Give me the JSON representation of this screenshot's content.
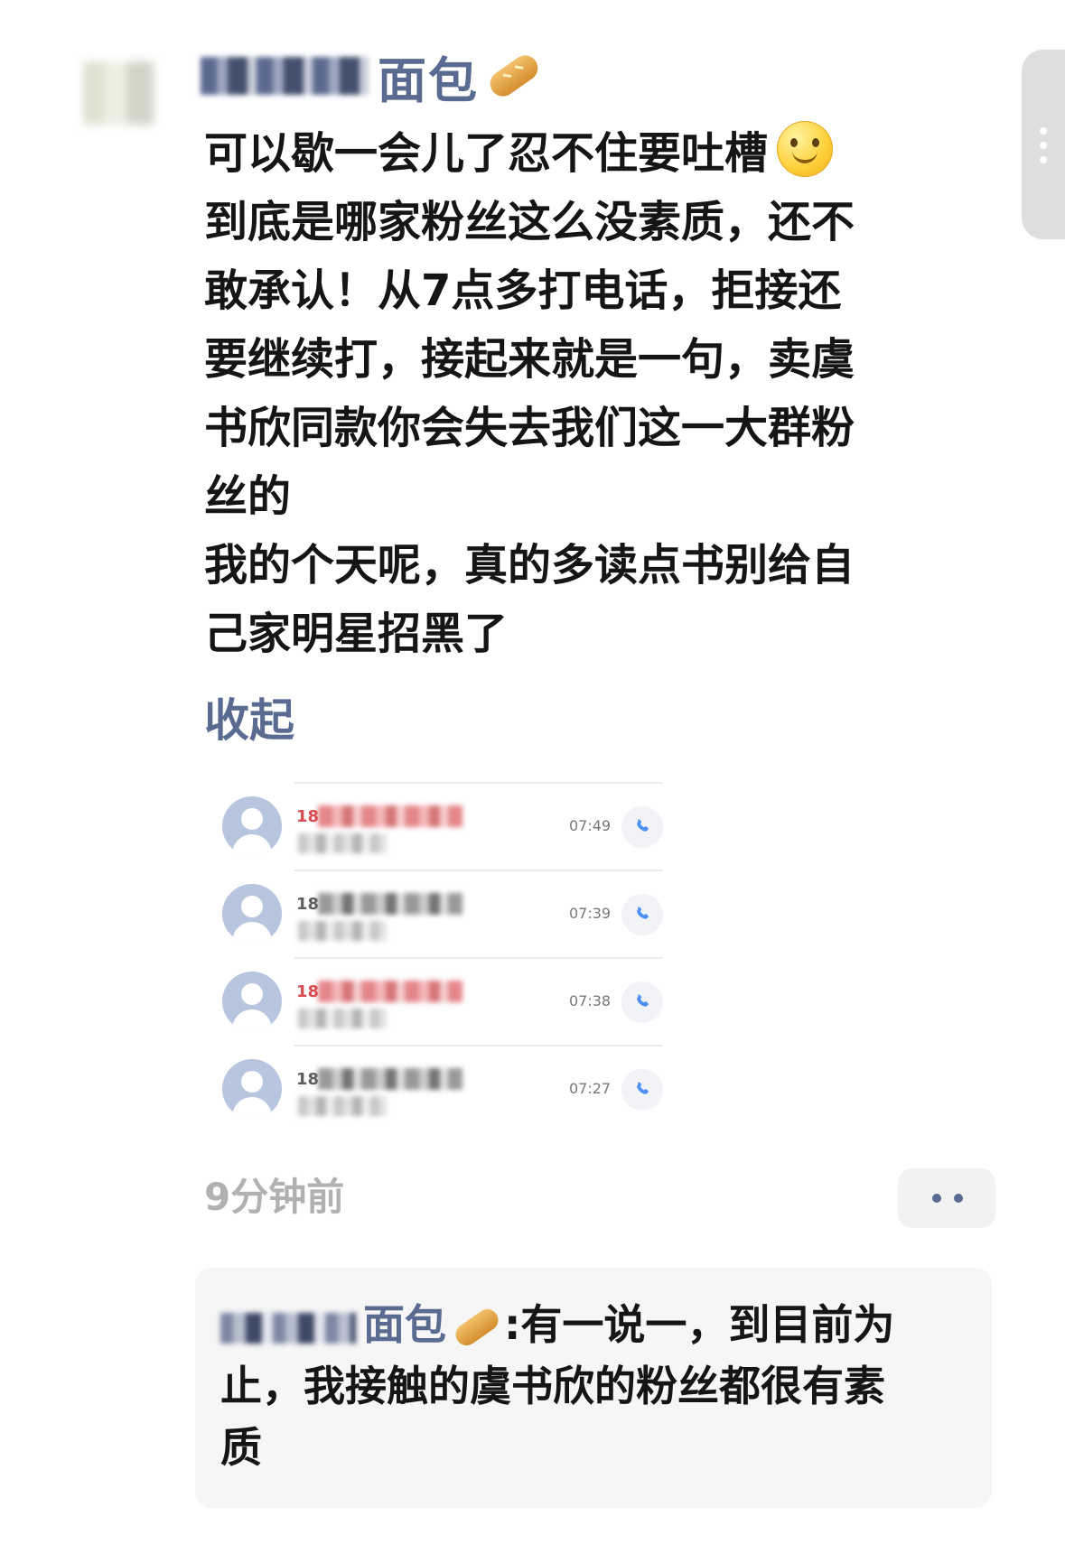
{
  "post": {
    "author_suffix": "面包",
    "author_icon": "baguette-bread-icon",
    "body_lines": [
      "可以歇一会儿了忍不住要吐槽",
      "到底是哪家粉丝这么没素质，还不",
      "敢承认！从7点多打电话，拒接还",
      "要继续打，接起来就是一句，卖虞",
      "书欣同款你会失去我们这一大群粉",
      "丝的",
      "我的个天呢，真的多读点书别给自",
      "己家明星招黑了"
    ],
    "emoji_icon": "smile-emoji-icon",
    "collapse_label": "收起",
    "timestamp": "9分钟前"
  },
  "call_log": {
    "entries": [
      {
        "number_prefix": "18",
        "time": "07:49",
        "status": "missed"
      },
      {
        "number_prefix": "18",
        "time": "07:39",
        "status": "outgoing"
      },
      {
        "number_prefix": "18",
        "time": "07:38",
        "status": "missed"
      },
      {
        "number_prefix": "18",
        "time": "07:27",
        "status": "incoming"
      }
    ],
    "call_button_icon": "phone-icon"
  },
  "comment": {
    "author_suffix": "面包",
    "separator": ":",
    "text_first": "有一说一，到目前为",
    "text_second": "止，我接触的虞书欣的粉丝都很有素",
    "text_third": "质"
  },
  "colors": {
    "link_blue": "#5a6b92",
    "missed_red": "#d84b50",
    "call_icon_blue": "#4b8ff5",
    "comment_background": "#f6f6f6"
  }
}
